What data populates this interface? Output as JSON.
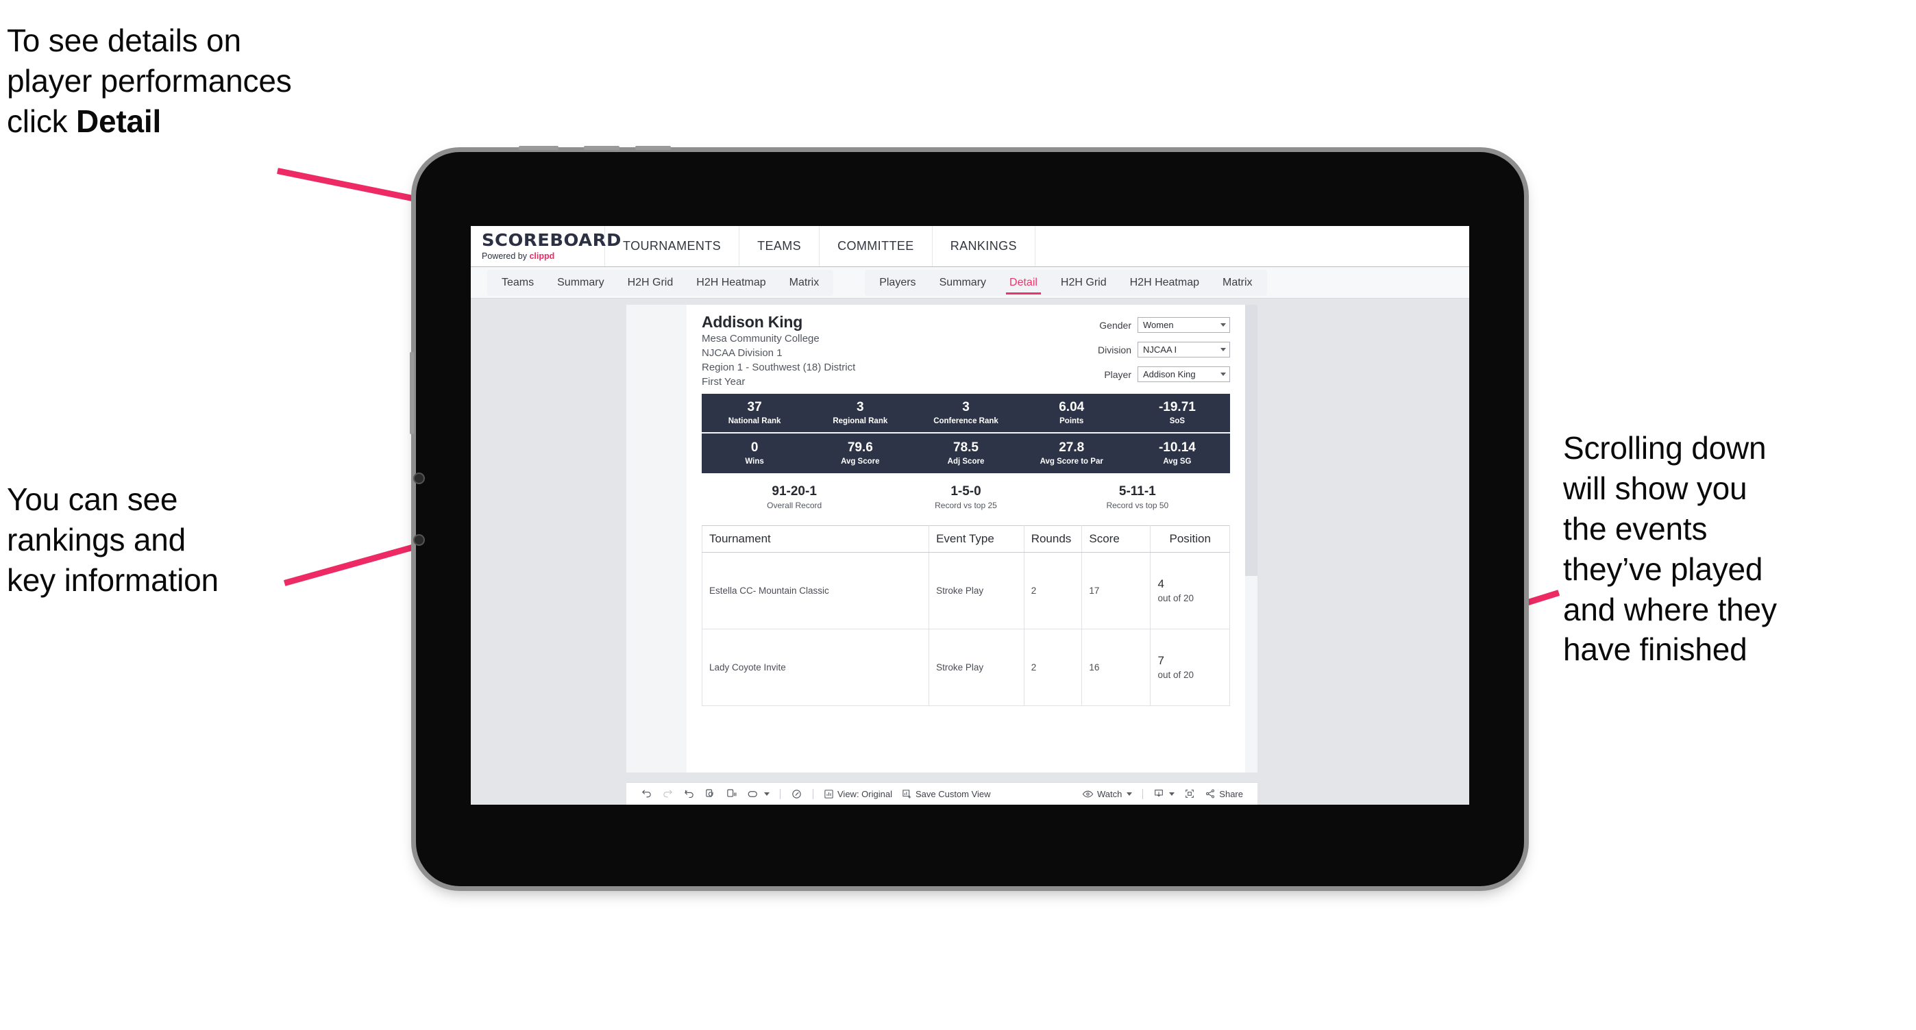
{
  "annotations": {
    "top_left": "To see details on\nplayer performances\nclick ",
    "top_left_bold": "Detail",
    "bottom_left": "You can see\nrankings and\nkey information",
    "right": "Scrolling down\nwill show you\nthe events\nthey’ve played\nand where they\nhave finished",
    "arrow_color": "#ed2a63"
  },
  "app": {
    "brand_name": "SCOREBOARD",
    "brand_sub_prefix": "Powered by ",
    "brand_sub_accent": "clippd",
    "accent_color": "#ed2a63",
    "top_nav": [
      "TOURNAMENTS",
      "TEAMS",
      "COMMITTEE",
      "RANKINGS"
    ],
    "tabs_teams": [
      "Teams",
      "Summary",
      "H2H Grid",
      "H2H Heatmap",
      "Matrix"
    ],
    "tabs_players": [
      "Players",
      "Summary",
      "Detail",
      "H2H Grid",
      "H2H Heatmap",
      "Matrix"
    ],
    "active_tab": "Detail"
  },
  "player": {
    "name": "Addison King",
    "school": "Mesa Community College",
    "division": "NJCAA Division 1",
    "region": "Region 1 - Southwest (18) District",
    "year": "First Year"
  },
  "filters": [
    {
      "label": "Gender",
      "value": "Women"
    },
    {
      "label": "Division",
      "value": "NJCAA I"
    },
    {
      "label": "Player",
      "value": "Addison King"
    }
  ],
  "stats_row_1": [
    {
      "value": "37",
      "label": "National Rank"
    },
    {
      "value": "3",
      "label": "Regional Rank"
    },
    {
      "value": "3",
      "label": "Conference Rank"
    },
    {
      "value": "6.04",
      "label": "Points"
    },
    {
      "value": "-19.71",
      "label": "SoS"
    }
  ],
  "stats_row_2": [
    {
      "value": "0",
      "label": "Wins"
    },
    {
      "value": "79.6",
      "label": "Avg Score"
    },
    {
      "value": "78.5",
      "label": "Adj Score"
    },
    {
      "value": "27.8",
      "label": "Avg Score to Par"
    },
    {
      "value": "-10.14",
      "label": "Avg SG"
    }
  ],
  "records": [
    {
      "value": "91-20-1",
      "label": "Overall Record"
    },
    {
      "value": "1-5-0",
      "label": "Record vs top 25"
    },
    {
      "value": "5-11-1",
      "label": "Record vs top 50"
    }
  ],
  "events_table": {
    "headers": [
      "Tournament",
      "Event Type",
      "Rounds",
      "Score",
      "Position"
    ],
    "rows": [
      {
        "tournament": "Estella CC- Mountain Classic",
        "event_type": "Stroke Play",
        "rounds": "2",
        "score": "17",
        "position_rank": "4",
        "position_of": "out of 20"
      },
      {
        "tournament": "Lady Coyote Invite",
        "event_type": "Stroke Play",
        "rounds": "2",
        "score": "16",
        "position_rank": "7",
        "position_of": "out of 20"
      }
    ]
  },
  "toolbar": {
    "view_label": "View: Original",
    "save_label": "Save Custom View",
    "watch_label": "Watch",
    "share_label": "Share"
  }
}
